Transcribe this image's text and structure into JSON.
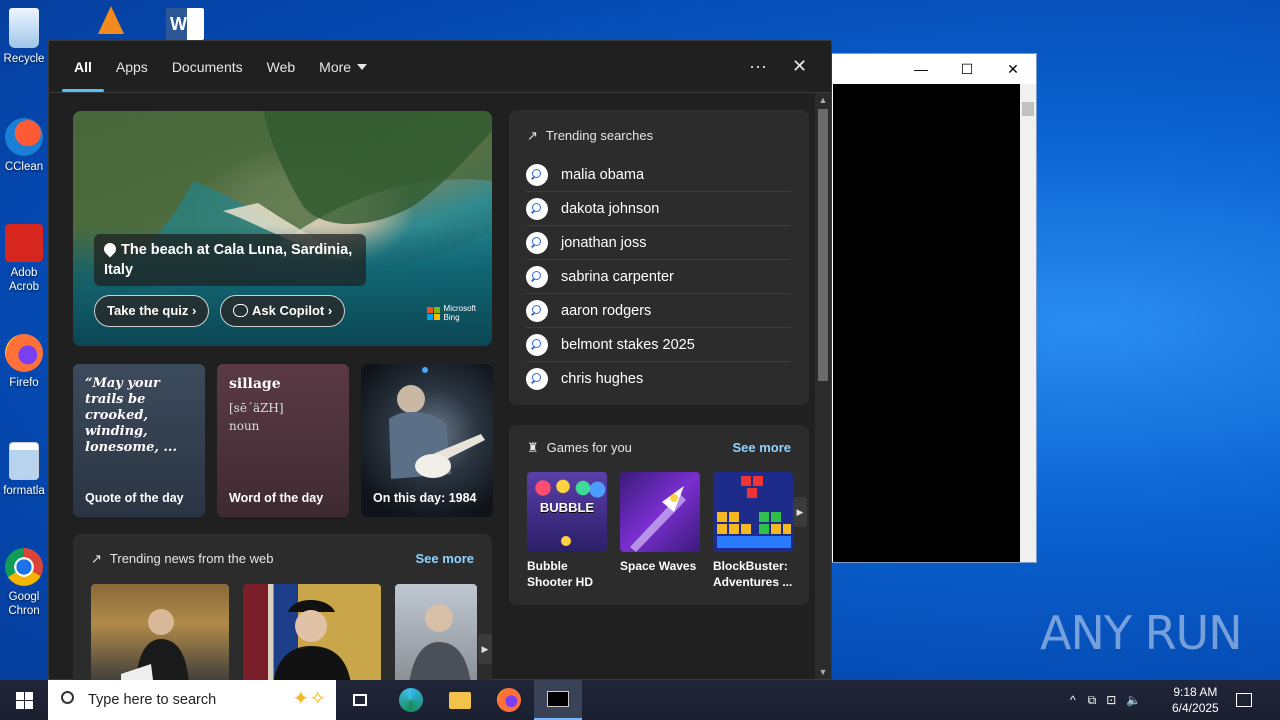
{
  "desktop": {
    "icons": [
      {
        "label": "Recycle"
      },
      {
        "label": "CClean"
      },
      {
        "label": "Adob"
      },
      {
        "label": "Acrob"
      },
      {
        "label": "Firefo"
      },
      {
        "label": "formatla"
      },
      {
        "label": "Googl"
      },
      {
        "label": "Chron"
      }
    ],
    "watermark": "ANY RUN"
  },
  "console_window": {
    "minimize": "—",
    "maximize": "☐",
    "close": "✕"
  },
  "search_panel": {
    "tabs": [
      {
        "label": "All"
      },
      {
        "label": "Apps"
      },
      {
        "label": "Documents"
      },
      {
        "label": "Web"
      },
      {
        "label": "More"
      }
    ],
    "more_options": "···",
    "close": "✕",
    "hero": {
      "location_line1": "The beach at Cala Luna, Sardinia,",
      "location_line2": "Italy",
      "quiz_button": "Take the quiz",
      "copilot_button": "Ask Copilot",
      "brand_line1": "Microsoft",
      "brand_line2": "Bing"
    },
    "cards": {
      "quote": {
        "text": "“May your trails be crooked, winding, lonesome, ...",
        "label": "Quote of the day"
      },
      "word": {
        "word": "sillage",
        "pron": "[sē´äZH]",
        "pos": "noun",
        "label": "Word of the day"
      },
      "history": {
        "label": "On this day: 1984"
      }
    },
    "news": {
      "header": "Trending news from the web",
      "see_more": "See more"
    },
    "trending": {
      "header": "Trending searches",
      "items": [
        "malia obama",
        "dakota johnson",
        "jonathan joss",
        "sabrina carpenter",
        "aaron rodgers",
        "belmont stakes 2025",
        "chris hughes"
      ]
    },
    "games": {
      "header": "Games for you",
      "see_more": "See more",
      "items": [
        {
          "name_line1": "Bubble",
          "name_line2": "Shooter HD",
          "art_text": "BUBBLE"
        },
        {
          "name_line1": "Space Waves",
          "name_line2": ""
        },
        {
          "name_line1": "BlockBuster:",
          "name_line2": "Adventures ..."
        }
      ]
    }
  },
  "taskbar": {
    "search_placeholder": "Type here to search",
    "time": "9:18 AM",
    "date": "6/4/2025"
  },
  "colors": {
    "accent": "#4cc2ff",
    "link": "#8fd3ff",
    "panel_bg": "#202020",
    "card_bg": "#2c2c2c"
  }
}
